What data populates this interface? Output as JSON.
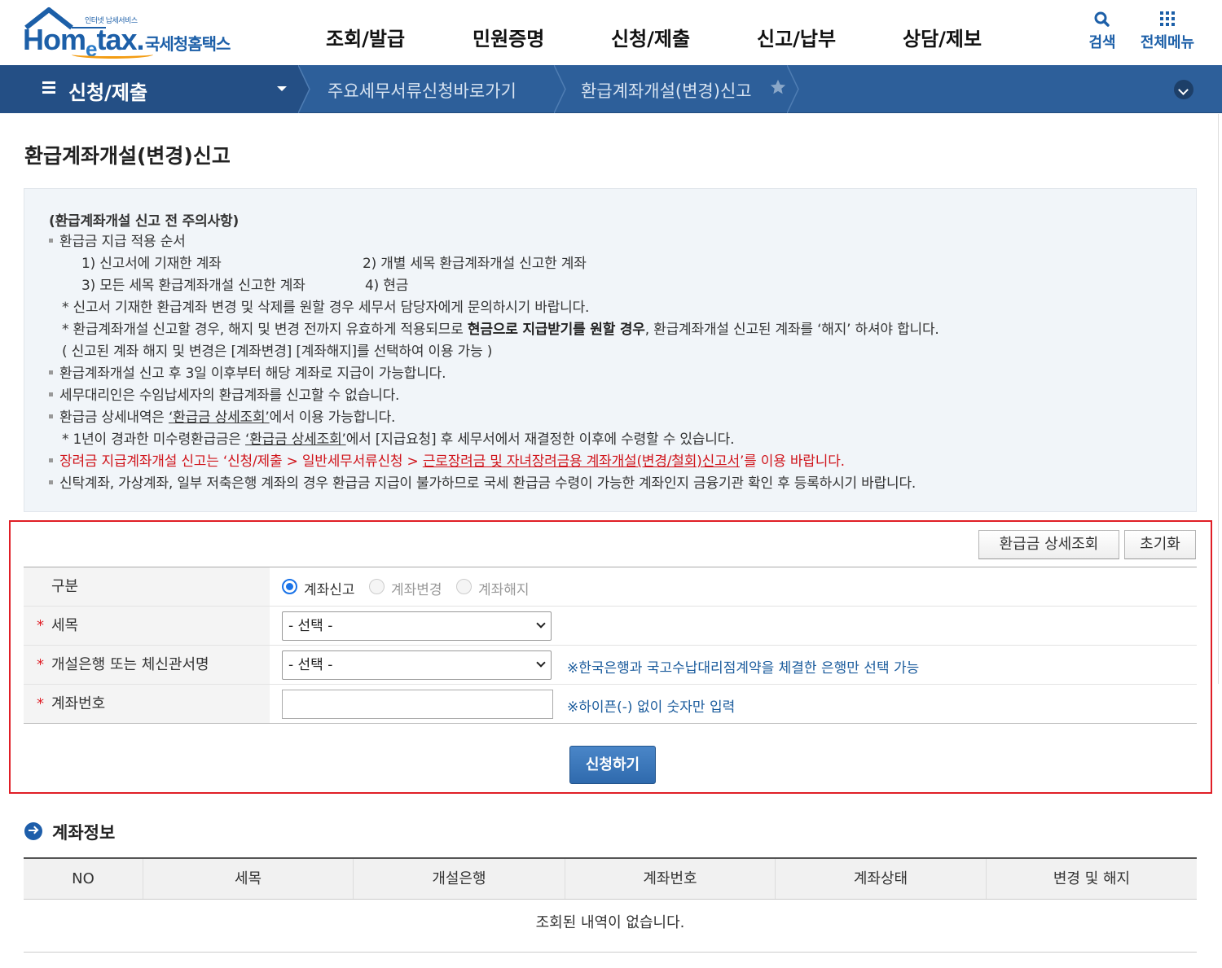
{
  "header": {
    "logo": {
      "small_text": "인터넷 납세서비스",
      "brand_pre": "Hom",
      "brand_e": "e",
      "brand_post": "tax.",
      "korean": "국세청홈택스"
    },
    "gnb": [
      "조회/발급",
      "민원증명",
      "신청/제출",
      "신고/납부",
      "상담/제보"
    ],
    "search_label": "검색",
    "all_menu_label": "전체메뉴"
  },
  "subnav": {
    "section": "신청/제출",
    "crumb1": "주요세무서류신청바로가기",
    "crumb2": "환급계좌개설(변경)신고"
  },
  "page": {
    "title": "환급계좌개설(변경)신고"
  },
  "notice": {
    "heading": "(환급계좌개설 신고 전 주의사항)",
    "order_title": "환급금 지급 적용 순서",
    "order1": "1) 신고서에 기재한 계좌",
    "order2": "2) 개별 세목 환급계좌개설 신고한 계좌",
    "order3": "3) 모든 세목 환급계좌개설 신고한 계좌",
    "order4": "4) 현금",
    "note1": "* 신고서 기재한 환급계좌 변경 및 삭제를 원할 경우 세무서 담당자에게 문의하시기 바랍니다.",
    "note2_a": "* 환급계좌개설 신고할 경우, 해지 및 변경 전까지 유효하게 적용되므로 ",
    "note2_b": "현금으로 지급받기를 원할 경우",
    "note2_c": ", 환급계좌개설 신고된 계좌를 ‘해지’ 하셔야 합니다.",
    "note3": "( 신고된 계좌 해지 및 변경은 [계좌변경] [계좌해지]를 선택하여 이용 가능 )",
    "bullet2": "환급계좌개설 신고 후 3일 이후부터 해당 계좌로 지급이 가능합니다.",
    "bullet3": "세무대리인은 수임납세자의 환급계좌를 신고할 수 없습니다.",
    "bullet4_a": "환급금 상세내역은 ",
    "bullet4_link": "‘환급금 상세조회’",
    "bullet4_b": "에서 이용 가능합니다.",
    "note4_a": "* 1년이 경과한 미수령환급금은 ",
    "note4_link": "‘환급금 상세조회’",
    "note4_b": "에서 [지급요청] 후 세무서에서 재결정한 이후에 수령할 수 있습니다.",
    "bullet5_a": "장려금 지급계좌개설 신고는 ‘신청/제출 > 일반세무서류신청 > ",
    "bullet5_link": "근로장려금 및 자녀장려금용 계좌개설(변경/철회)신고서",
    "bullet5_b": "’를 이용 바랍니다.",
    "bullet6": "신탁계좌, 가상계좌, 일부 저축은행 계좌의 경우 환급금 지급이 불가하므로 국세 환급금 수령이 가능한 계좌인지 금융기관 확인 후 등록하시기 바랍니다."
  },
  "form": {
    "btn_refund_detail": "환급금 상세조회",
    "btn_reset": "초기화",
    "type_label": "구분",
    "radio_options": [
      "계좌신고",
      "계좌변경",
      "계좌해지"
    ],
    "selected_radio": "계좌신고",
    "required_mark": "*",
    "tax_label": "세목",
    "tax_select": "- 선택 -",
    "bank_label": "개설은행 또는 체신관서명",
    "bank_select": "- 선택 -",
    "bank_hint": "※한국은행과 국고수납대리점계약을 체결한 은행만 선택 가능",
    "account_label": "계좌번호",
    "account_value": "",
    "account_hint": "※하이픈(-) 없이 숫자만 입력",
    "submit": "신청하기"
  },
  "account_info": {
    "title": "계좌정보",
    "columns": [
      "NO",
      "세목",
      "개설은행",
      "계좌번호",
      "계좌상태",
      "변경 및 해지"
    ],
    "empty_message": "조회된 내역이 없습니다."
  },
  "colors": {
    "nav_blue": "#2d5f9a",
    "brand_blue": "#1c5fa8",
    "highlight_red": "#e01e26",
    "notice_red": "#d0151c",
    "hint_blue": "#1a5b9c"
  },
  "icons": [
    "house-roof-icon",
    "search-icon",
    "grid-menu-icon",
    "hamburger-icon",
    "caret-down-icon",
    "star-icon",
    "chevron-down-circle-icon",
    "arrow-circle-icon",
    "select-chevron-icon"
  ]
}
